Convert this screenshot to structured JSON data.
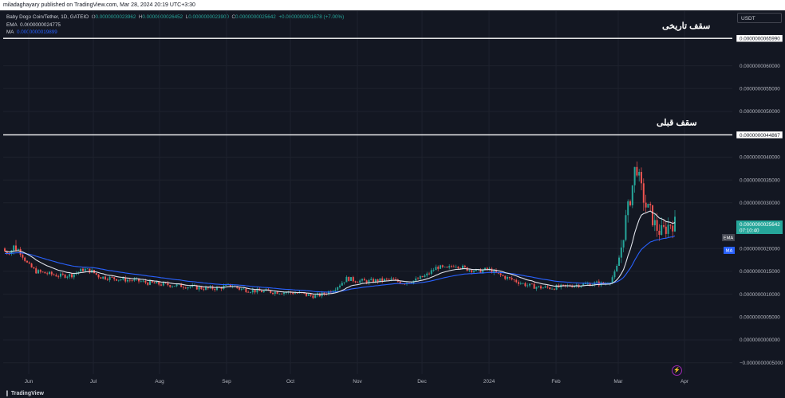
{
  "header": {
    "publish_line": "miladaghayary published on TradingView.com, Mar 28, 2024 20:19 UTC+3:30"
  },
  "legend": {
    "symbol": "Baby Doge Coin/Tether, 1D, GATEIO",
    "o_label": "O",
    "o_value": "0.0000000023962",
    "h_label": "H",
    "h_value": "0.0000000026452",
    "l_label": "L",
    "l_value": "0.0000000023900",
    "c_label": "C",
    "c_value": "0.0000000025642",
    "change": "+0.0000000001678 (+7.00%)",
    "ema_label": "EMA",
    "ema_value": "0.0000000024775",
    "ma_label": "MA",
    "ma_value": "0.0000000019899"
  },
  "toolbar": {
    "currency": "USDT"
  },
  "footer": {
    "brand": "TradingView"
  },
  "chart_data": {
    "type": "candlestick",
    "title": "Baby Doge Coin/Tether, 1D, GATEIO",
    "ylim": [
      -5e-10,
      6.8e-09
    ],
    "y_ticks": [
      {
        "v": 6e-09,
        "label": "0.0000000060000"
      },
      {
        "v": 5.5e-09,
        "label": "0.0000000055000"
      },
      {
        "v": 5e-09,
        "label": "0.0000000050000"
      },
      {
        "v": 4e-09,
        "label": "0.0000000040000"
      },
      {
        "v": 3.5e-09,
        "label": "0.0000000035000"
      },
      {
        "v": 3e-09,
        "label": "0.0000000030000"
      },
      {
        "v": 2e-09,
        "label": "0.0000000020000"
      },
      {
        "v": 1.5e-09,
        "label": "0.0000000015000"
      },
      {
        "v": 1e-09,
        "label": "0.0000000010000"
      },
      {
        "v": 5e-10,
        "label": "0.0000000005000"
      },
      {
        "v": 0,
        "label": "0.0000000000000"
      },
      {
        "v": -5e-10,
        "label": "−0.0000000005000"
      }
    ],
    "x_ticks": [
      "Jun",
      "Jul",
      "Aug",
      "Sep",
      "Oct",
      "Nov",
      "Dec",
      "2024",
      "Feb",
      "Mar",
      "Apr"
    ],
    "horizontal_lines": [
      {
        "value": 6.599e-09,
        "price_label": "0.0000000065990",
        "annotation": "سقف تاریخی"
      },
      {
        "value": 4.4867e-09,
        "price_label": "0.0000000044867",
        "annotation": "سقف قبلی"
      }
    ],
    "last_price": {
      "label": "0.0000000025642",
      "countdown": "07:10:40"
    },
    "indicator_tags": {
      "ema": "EMA",
      "ma": "MA"
    },
    "colors": {
      "up": "#26a69a",
      "down": "#ef5350",
      "ema": "#e0e3eb",
      "ma": "#2962ff",
      "background": "#131722"
    },
    "price_path": [
      [
        0,
        2.0
      ],
      [
        10,
        1.9
      ],
      [
        20,
        2.05
      ],
      [
        28,
        1.85
      ],
      [
        35,
        1.65
      ],
      [
        45,
        1.5
      ],
      [
        60,
        1.45
      ],
      [
        75,
        1.4
      ],
      [
        90,
        1.42
      ],
      [
        105,
        1.55
      ],
      [
        115,
        1.5
      ],
      [
        125,
        1.38
      ],
      [
        140,
        1.35
      ],
      [
        155,
        1.32
      ],
      [
        170,
        1.3
      ],
      [
        185,
        1.25
      ],
      [
        200,
        1.22
      ],
      [
        215,
        1.2
      ],
      [
        230,
        1.18
      ],
      [
        245,
        1.15
      ],
      [
        260,
        1.12
      ],
      [
        275,
        1.14
      ],
      [
        290,
        1.2
      ],
      [
        300,
        1.12
      ],
      [
        315,
        1.08
      ],
      [
        330,
        1.06
      ],
      [
        345,
        1.05
      ],
      [
        360,
        1.04
      ],
      [
        375,
        1.02
      ],
      [
        385,
        0.98
      ],
      [
        395,
        0.96
      ],
      [
        405,
        1.0
      ],
      [
        415,
        1.08
      ],
      [
        425,
        1.2
      ],
      [
        435,
        1.35
      ],
      [
        445,
        1.3
      ],
      [
        460,
        1.28
      ],
      [
        475,
        1.3
      ],
      [
        490,
        1.32
      ],
      [
        505,
        1.25
      ],
      [
        520,
        1.3
      ],
      [
        535,
        1.42
      ],
      [
        548,
        1.6
      ],
      [
        560,
        1.55
      ],
      [
        570,
        1.65
      ],
      [
        585,
        1.55
      ],
      [
        600,
        1.5
      ],
      [
        612,
        1.55
      ],
      [
        622,
        1.45
      ],
      [
        632,
        1.38
      ],
      [
        645,
        1.3
      ],
      [
        660,
        1.2
      ],
      [
        675,
        1.15
      ],
      [
        690,
        1.14
      ],
      [
        705,
        1.16
      ],
      [
        720,
        1.2
      ],
      [
        735,
        1.22
      ],
      [
        748,
        1.24
      ],
      [
        758,
        1.22
      ],
      [
        765,
        1.3
      ],
      [
        772,
        1.5
      ],
      [
        778,
        1.95
      ],
      [
        784,
        2.6
      ],
      [
        790,
        3.1
      ],
      [
        794,
        3.5
      ],
      [
        797,
        3.9
      ],
      [
        800,
        3.6
      ],
      [
        805,
        3.2
      ],
      [
        810,
        2.9
      ],
      [
        815,
        2.8
      ],
      [
        820,
        2.55
      ],
      [
        825,
        2.4
      ],
      [
        830,
        2.35
      ],
      [
        835,
        2.45
      ],
      [
        840,
        2.55
      ],
      [
        846,
        2.55
      ]
    ]
  }
}
